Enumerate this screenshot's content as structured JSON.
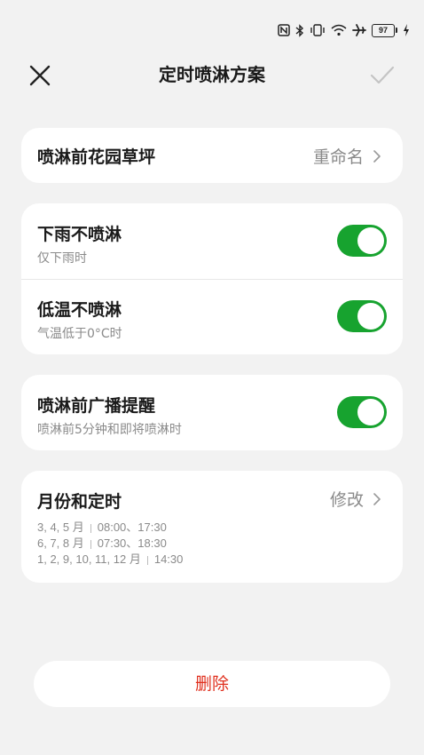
{
  "status_bar": {
    "icons": [
      "nfc-icon",
      "bluetooth-icon",
      "vibrate-icon",
      "wifi-icon",
      "airplane-icon"
    ],
    "battery_level": "97"
  },
  "header": {
    "title": "定时喷淋方案",
    "close_icon": "close-icon",
    "confirm_icon": "check-icon"
  },
  "name_card": {
    "name": "喷淋前花园草坪",
    "rename_label": "重命名"
  },
  "conditions": [
    {
      "title": "下雨不喷淋",
      "subtitle": "仅下雨时",
      "enabled": true
    },
    {
      "title": "低温不喷淋",
      "subtitle": "气温低于0°C时",
      "enabled": true
    }
  ],
  "broadcast": {
    "title": "喷淋前广播提醒",
    "subtitle": "喷淋前5分钟和即将喷淋时",
    "enabled": true
  },
  "schedule": {
    "title": "月份和定时",
    "edit_label": "修改",
    "entries": [
      {
        "months": "3, 4, 5 月",
        "times": "08:00、17:30"
      },
      {
        "months": "6, 7, 8 月",
        "times": "07:30、18:30"
      },
      {
        "months": "1, 2, 9, 10, 11, 12 月",
        "times": "14:30"
      }
    ]
  },
  "delete_label": "删除",
  "colors": {
    "toggle_on": "#17a32f",
    "delete_text": "#e0301e",
    "background": "#f2f2f2"
  }
}
